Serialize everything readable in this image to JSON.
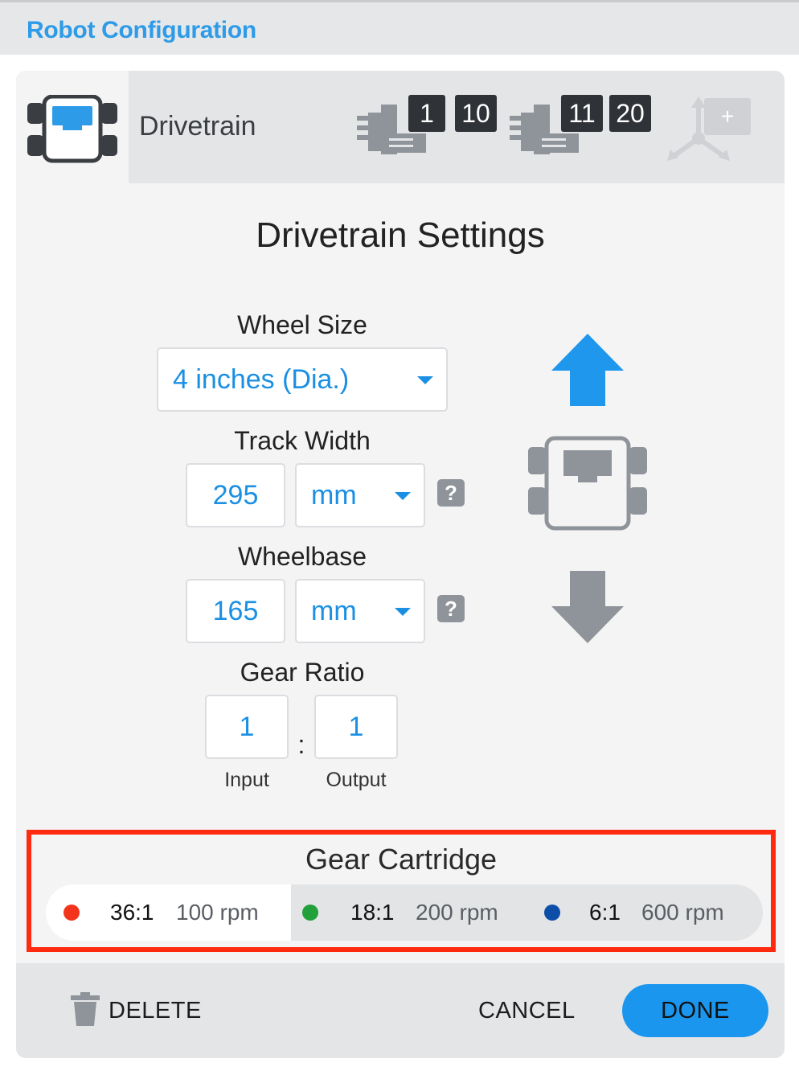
{
  "app": {
    "title": "Robot Configuration"
  },
  "device": {
    "name": "Drivetrain",
    "ports": [
      {
        "a": "1",
        "b": "10"
      },
      {
        "a": "11",
        "b": "20"
      }
    ],
    "gyro_add_label": "+"
  },
  "settings": {
    "heading": "Drivetrain Settings",
    "wheel_size": {
      "label": "Wheel Size",
      "value": "4 inches (Dia.)"
    },
    "track_width": {
      "label": "Track Width",
      "value": "295",
      "unit": "mm"
    },
    "wheelbase": {
      "label": "Wheelbase",
      "value": "165",
      "unit": "mm"
    },
    "gear_ratio": {
      "label": "Gear Ratio",
      "input": "1",
      "output": "1",
      "separator": ":",
      "input_label": "Input",
      "output_label": "Output"
    },
    "help_glyph": "?"
  },
  "gear_cartridge": {
    "heading": "Gear Cartridge",
    "selected_index": 0,
    "options": [
      {
        "ratio": "36:1",
        "rpm": "100 rpm",
        "color": "#f2341c"
      },
      {
        "ratio": "18:1",
        "rpm": "200 rpm",
        "color": "#22a03a"
      },
      {
        "ratio": "6:1",
        "rpm": "600 rpm",
        "color": "#0d4fa8"
      }
    ]
  },
  "footer": {
    "delete": "DELETE",
    "cancel": "CANCEL",
    "done": "DONE"
  },
  "colors": {
    "accent": "#1a96ef",
    "highlight_border": "#ff2a10"
  }
}
